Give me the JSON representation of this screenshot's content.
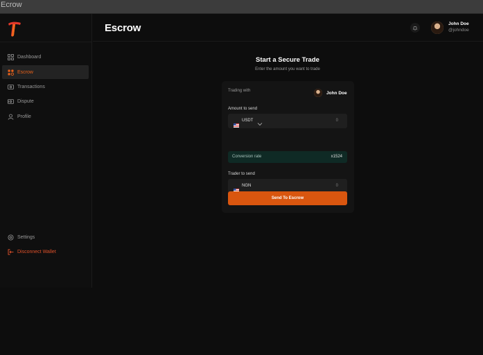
{
  "window": {
    "title": "Ecrow"
  },
  "sidebar": {
    "logo_icon": "brand-logo-icon",
    "items": [
      {
        "label": "Dashboard",
        "icon": "dashboard-grid-icon",
        "active": false
      },
      {
        "label": "Escrow",
        "icon": "escrow-icon",
        "active": true
      },
      {
        "label": "Transactions",
        "icon": "transactions-icon",
        "active": false
      },
      {
        "label": "Dispute",
        "icon": "dispute-icon",
        "active": false
      },
      {
        "label": "Profile",
        "icon": "profile-icon",
        "active": false
      }
    ],
    "bottom_items": [
      {
        "label": "Settings",
        "icon": "settings-icon"
      },
      {
        "label": "Disconnect Wallet",
        "icon": "disconnect-icon"
      }
    ]
  },
  "header": {
    "title": "Escrow",
    "notification_icon": "bell-icon",
    "user": {
      "name": "John Doe",
      "handle": "@johndoe"
    }
  },
  "trade": {
    "title": "Start a Secure Trade",
    "subtitle": "Enter the amount you want to trade",
    "trading_with_label": "Trading with",
    "trading_with_user": "John Doe",
    "amount_label": "Amount to send",
    "amount_currency": "USDT",
    "amount_value": "0",
    "conversion_label": "Conversion rate",
    "conversion_value": "x1524",
    "trader_label": "Trader to send",
    "trader_currency": "NGN",
    "trader_value": "0",
    "submit_label": "Send To Escrow"
  },
  "colors": {
    "accent": "#d9560f",
    "active_text": "#e8611a",
    "background": "#0d0d0d",
    "card": "#141414",
    "rate_background": "#0f2a25"
  }
}
